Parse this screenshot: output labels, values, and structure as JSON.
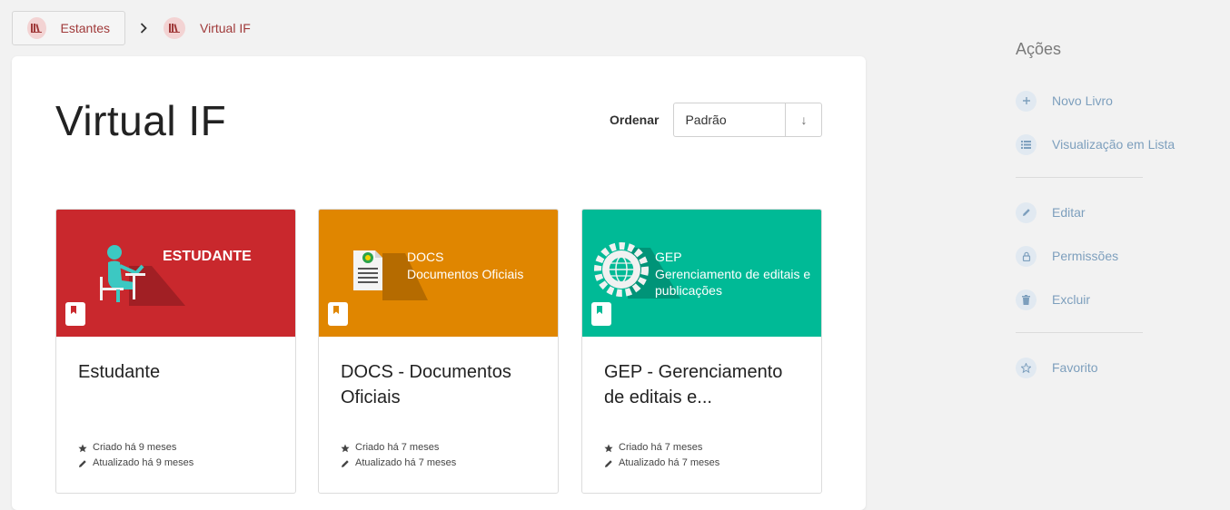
{
  "breadcrumb": {
    "items": [
      {
        "label": "Estantes"
      },
      {
        "label": "Virtual IF"
      }
    ]
  },
  "page": {
    "title": "Virtual IF"
  },
  "sort": {
    "label": "Ordenar",
    "selected": "Padrão",
    "direction_symbol": "↓"
  },
  "books": [
    {
      "name": "Estudante",
      "cover": {
        "color": "#c9282d",
        "heading": "ESTUDANTE",
        "subheading": ""
      },
      "created": "Criado há 9 meses",
      "updated": "Atualizado há 9 meses"
    },
    {
      "name": "DOCS - Documentos Oficiais",
      "cover": {
        "color": "#e08600",
        "heading": "DOCS",
        "subheading": "Documentos Oficiais"
      },
      "created": "Criado há 7 meses",
      "updated": "Atualizado há 7 meses"
    },
    {
      "name": "GEP - Gerenciamento de editais e...",
      "cover": {
        "color": "#00ba96",
        "heading": "GEP",
        "subheading": "Gerenciamento de editais e publicações"
      },
      "created": "Criado há 7 meses",
      "updated": "Atualizado há 7 meses"
    }
  ],
  "sidebar": {
    "heading": "Ações",
    "actions": [
      {
        "label": "Novo Livro",
        "icon": "plus-icon"
      },
      {
        "label": "Visualização em Lista",
        "icon": "list-icon"
      },
      {
        "label": "Editar",
        "icon": "pencil-icon"
      },
      {
        "label": "Permissões",
        "icon": "lock-icon"
      },
      {
        "label": "Excluir",
        "icon": "trash-icon"
      },
      {
        "label": "Favorito",
        "icon": "star-icon"
      }
    ]
  },
  "colors": {
    "breadcrumb_text": "#a03a3a",
    "action_text": "#7d9fbd",
    "estudante_cover": "#c9282d",
    "docs_cover": "#e08600",
    "gep_cover": "#00ba96"
  }
}
